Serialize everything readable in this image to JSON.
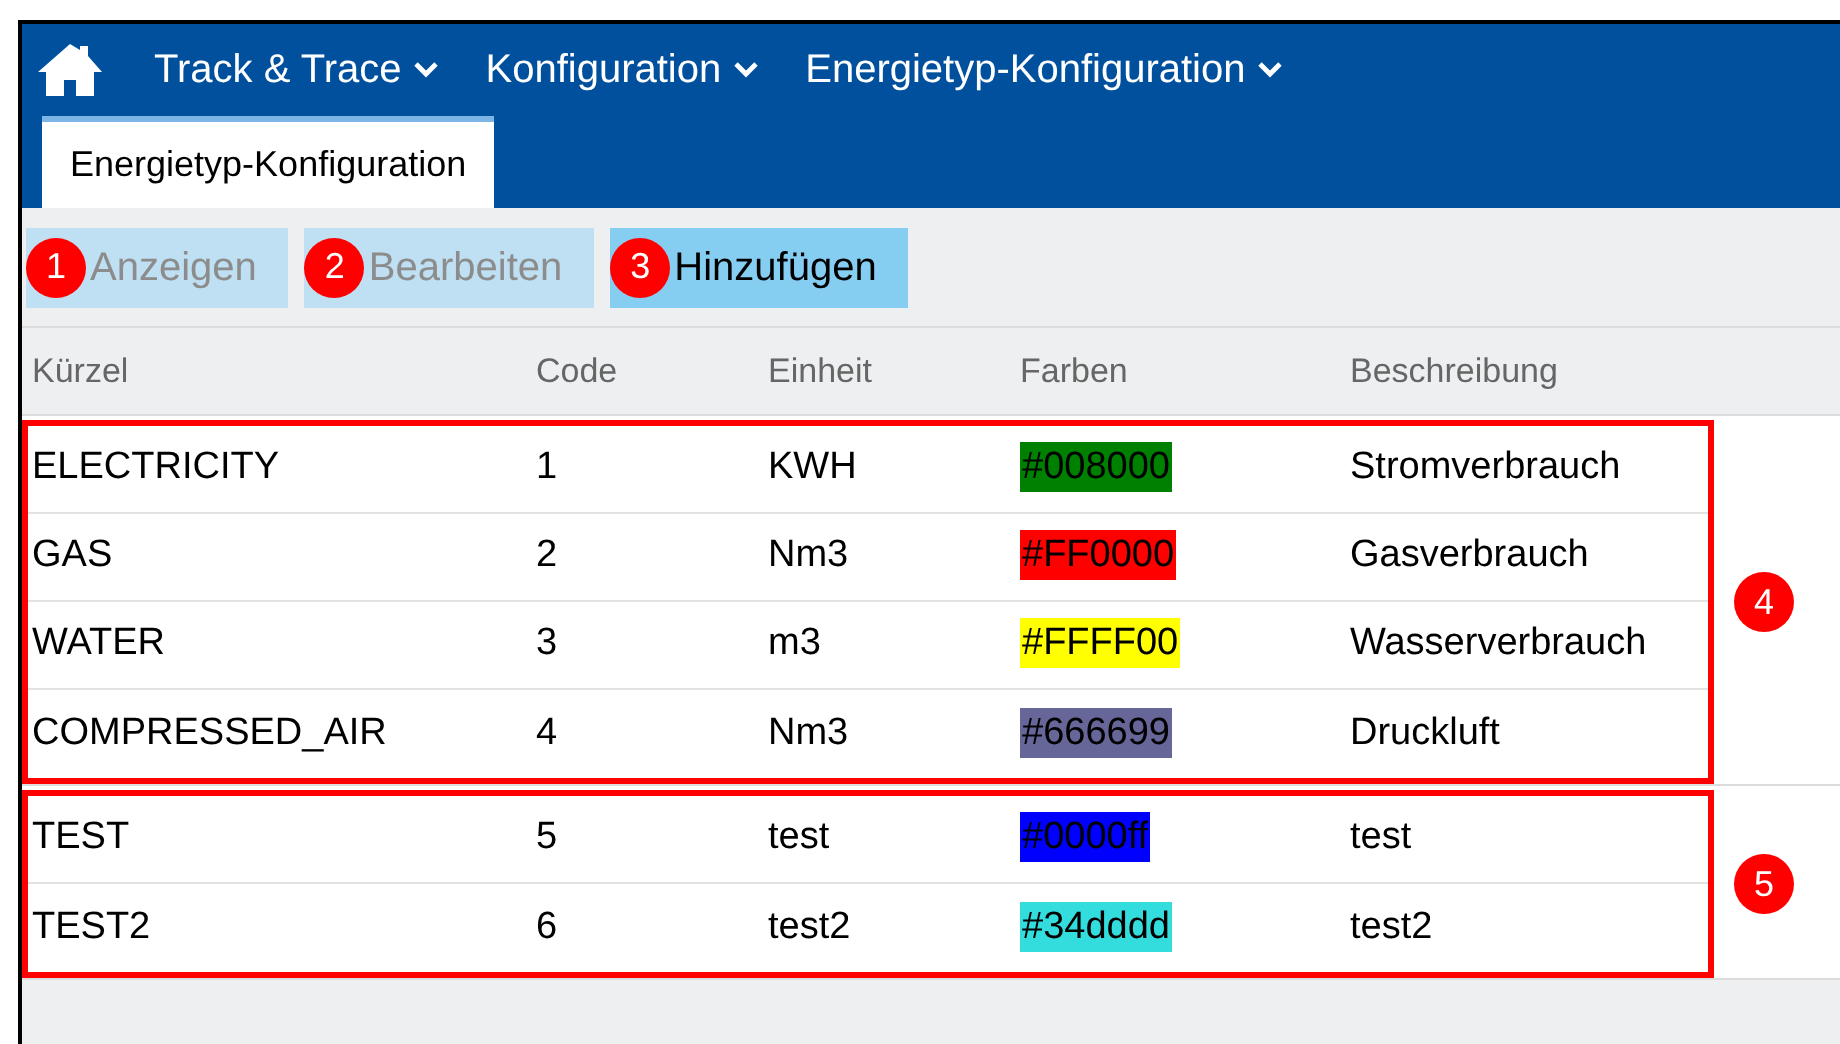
{
  "nav": {
    "items": [
      {
        "label": "Track & Trace"
      },
      {
        "label": "Konfiguration"
      },
      {
        "label": "Energietyp-Konfiguration"
      }
    ]
  },
  "tabs": [
    {
      "label": "Energietyp-Konfiguration",
      "selected": true
    }
  ],
  "toolbar": {
    "buttons": [
      {
        "label": "Anzeigen",
        "badge": "1",
        "disabled": true
      },
      {
        "label": "Bearbeiten",
        "badge": "2",
        "disabled": true
      },
      {
        "label": "Hinzufügen",
        "badge": "3",
        "disabled": false
      }
    ]
  },
  "table": {
    "columns": [
      "Kürzel",
      "Code",
      "Einheit",
      "Farben",
      "Beschreibung"
    ],
    "groups": [
      {
        "badge": "4",
        "rows": [
          {
            "cells": [
              "ELECTRICITY",
              "1",
              "KWH",
              "#008000",
              "Stromverbrauch"
            ],
            "color": "#008000"
          },
          {
            "cells": [
              "GAS",
              "2",
              "Nm3",
              "#FF0000",
              "Gasverbrauch"
            ],
            "color": "#ff0000"
          },
          {
            "cells": [
              "WATER",
              "3",
              "m3",
              "#FFFF00",
              "Wasserverbrauch"
            ],
            "color": "#ffff00"
          },
          {
            "cells": [
              "COMPRESSED_AIR",
              "4",
              "Nm3",
              "#666699",
              "Druckluft"
            ],
            "color": "#666699"
          }
        ]
      },
      {
        "badge": "5",
        "rows": [
          {
            "cells": [
              "TEST",
              "5",
              "test",
              "#0000ff",
              "test"
            ],
            "color": "#0000ff"
          },
          {
            "cells": [
              "TEST2",
              "6",
              "test2",
              "#34dddd",
              "test2"
            ],
            "color": "#34dddd"
          }
        ]
      }
    ]
  }
}
